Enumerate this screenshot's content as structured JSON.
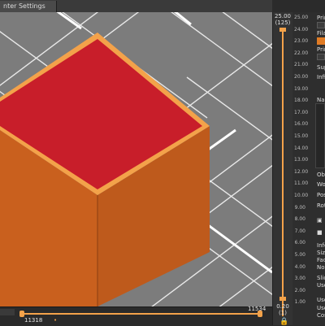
{
  "tab": {
    "label": "nter Settings"
  },
  "layer_slider": {
    "top_height": "25.00",
    "top_layer": "(125)",
    "bottom_height": "0.20",
    "bottom_layer": "(1)",
    "ticks": [
      "25.00",
      "24.00",
      "23.00",
      "22.00",
      "21.00",
      "20.00",
      "19.00",
      "18.00",
      "17.00",
      "16.00",
      "15.00",
      "14.00",
      "13.00",
      "12.00",
      "11.00",
      "10.00",
      "9.00",
      "8.00",
      "7.00",
      "6.00",
      "5.00",
      "4.00",
      "3.00",
      "2.00",
      "1.00"
    ]
  },
  "horizontal_slider": {
    "left_value": "11318",
    "right_value": "11534"
  },
  "sidebar": {
    "print_label": "Print",
    "filament_label": "Filam",
    "print2_label": "Print",
    "support_label": "Supp",
    "infill_label": "Infill",
    "name_label": "Nam",
    "object_label": "Ob",
    "wo_label": "Wo",
    "pos_label": "Pos",
    "rot_label": "Rot",
    "info_label": "Info",
    "size_label": "Size",
    "face_label": "Face",
    "no_label": "No",
    "slice_label": "Slic",
    "used1_label": "Use",
    "used2_label": "Use",
    "used3_label": "Use",
    "cost_label": "Cos",
    "filament_color": "#e07b24"
  },
  "colors": {
    "accent": "#f3a24a",
    "model_side": "#c9611f",
    "model_top": "#c81e2a"
  }
}
